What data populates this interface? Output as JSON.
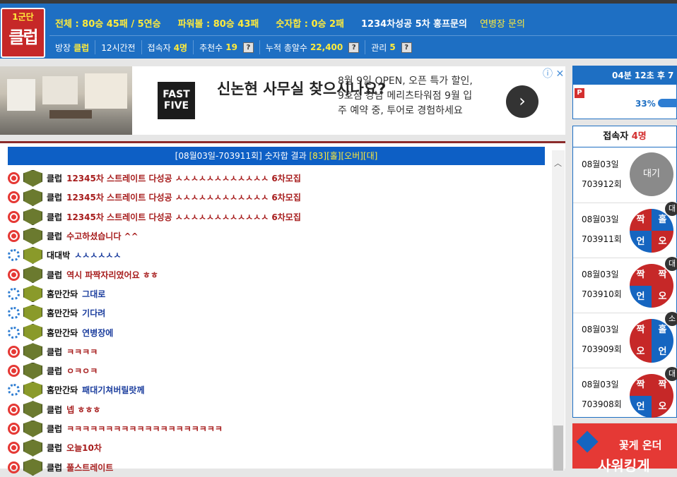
{
  "logo": {
    "line1": "1군단",
    "line2": "클럽"
  },
  "stats": {
    "total": "전체 : 80승 45패 / 5연승",
    "powerball": "파워볼 : 80승 43패",
    "numsum": "숫자합 : 0승 2패",
    "promo": "1234차성공 5차 홍프문의",
    "inquiry": "연병장 문의"
  },
  "info": {
    "host_label": "방장",
    "host_val": "클럽",
    "time": "12시간전",
    "users_label": "접속자",
    "users_val": "4명",
    "recommend_label": "추천수",
    "recommend_val": "19",
    "total_label": "누적 총알수",
    "total_val": "22,400",
    "manage_label": "관리",
    "manage_val": "5",
    "q": "?"
  },
  "ad": {
    "logo_text": "FAST FIVE",
    "headline": "신논현 사무실 찾으시나요?",
    "body": "8월 9일 OPEN, 오픈 특가 할인, 9호점 강남 메리츠타워점 9월 입주 예약 중, 투어로 경험하세요",
    "arrow": "›",
    "close": "ⓘ ✕"
  },
  "result": {
    "prefix": "[08월03일-703911회] 숫자합 결과 ",
    "value": "[83][홀][오버][대]"
  },
  "chat": [
    {
      "type": "r",
      "nick": "클럽",
      "msg": "12345차 스트레이트 다성공 ㅅㅅㅅㅅㅅㅅㅅㅅㅅㅅㅅㅅ 6차모집",
      "color": "red"
    },
    {
      "type": "r",
      "nick": "클럽",
      "msg": "12345차 스트레이트 다성공 ㅅㅅㅅㅅㅅㅅㅅㅅㅅㅅㅅㅅ 6차모집",
      "color": "red"
    },
    {
      "type": "r",
      "nick": "클럽",
      "msg": "12345차 스트레이트 다성공 ㅅㅅㅅㅅㅅㅅㅅㅅㅅㅅㅅㅅ 6차모집",
      "color": "red"
    },
    {
      "type": "r",
      "nick": "클럽",
      "msg": "수고하셨습니다 ^^",
      "color": "red"
    },
    {
      "type": "b",
      "nick": "대대박",
      "msg": "ㅅㅅㅅㅅㅅㅅ",
      "color": "blue"
    },
    {
      "type": "r",
      "nick": "클럽",
      "msg": "역시 파짝자리였어요 ㅎㅎ",
      "color": "red"
    },
    {
      "type": "b",
      "nick": "홈만간돠",
      "msg": "그대로",
      "color": "blue"
    },
    {
      "type": "b",
      "nick": "홈만간돠",
      "msg": "기다려",
      "color": "blue"
    },
    {
      "type": "b",
      "nick": "홈만간돠",
      "msg": "연병장에",
      "color": "blue"
    },
    {
      "type": "r",
      "nick": "클럽",
      "msg": "ㅋㅋㅋㅋ",
      "color": "red"
    },
    {
      "type": "r",
      "nick": "클럽",
      "msg": "ㅇㅋㅇㅋ",
      "color": "red"
    },
    {
      "type": "b",
      "nick": "홈만간돠",
      "msg": "패대기쳐버릴랏께",
      "color": "blue"
    },
    {
      "type": "r",
      "nick": "클럽",
      "msg": "넵 ㅎㅎㅎ",
      "color": "red"
    },
    {
      "type": "r",
      "nick": "클럽",
      "msg": "ㅋㅋㅋㅋㅋㅋㅋㅋㅋㅋㅋㅋㅋㅋㅋㅋㅋㅋㅋㅋ",
      "color": "red"
    },
    {
      "type": "r",
      "nick": "클럽",
      "msg": "오늘10차",
      "color": "red"
    },
    {
      "type": "r",
      "nick": "클럽",
      "msg": "풀스트레이트",
      "color": "red"
    }
  ],
  "timer": {
    "text": "04분 12초 후 7",
    "flag": "P",
    "percent": "33%"
  },
  "connect": {
    "title": "접속자",
    "count": "4명"
  },
  "rounds": [
    {
      "date": "08월03일",
      "round": "703912회",
      "wait": "대기"
    },
    {
      "date": "08월03일",
      "round": "703911회",
      "tl": "짝",
      "tr": "홀",
      "bl": "언",
      "br": "오",
      "tag": "대"
    },
    {
      "date": "08월03일",
      "round": "703910회",
      "tl": "짝",
      "tr": "짝",
      "bl": "언",
      "br": "오",
      "tag": "대"
    },
    {
      "date": "08월03일",
      "round": "703909회",
      "tl": "짝",
      "tr": "홀",
      "bl": "오",
      "br": "언",
      "tag": "소"
    },
    {
      "date": "08월03일",
      "round": "703908회",
      "tl": "짝",
      "tr": "짝",
      "bl": "언",
      "br": "오",
      "tag": "대"
    }
  ],
  "bottom_ad": {
    "t1": "꽃게 온더",
    "t2": "사워킹게"
  },
  "colors": {
    "header_blue": "#1e6fc3",
    "accent_yellow": "#ffeb3b",
    "brand_red": "#c62828"
  }
}
